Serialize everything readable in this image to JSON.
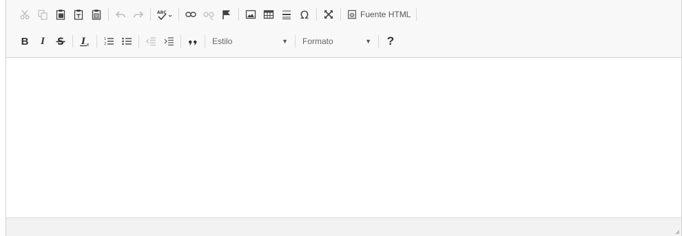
{
  "toolbar": {
    "row1": {
      "buttons": [
        {
          "name": "cut-button",
          "icon": "scissors-icon",
          "enabled": false
        },
        {
          "name": "copy-button",
          "icon": "copy-icon",
          "enabled": false
        },
        {
          "name": "paste-button",
          "icon": "clipboard-icon",
          "enabled": true
        },
        {
          "name": "paste-text-button",
          "icon": "clipboard-text-icon",
          "enabled": true
        },
        {
          "name": "paste-word-button",
          "icon": "clipboard-word-icon",
          "enabled": true
        },
        {
          "name": "undo-button",
          "icon": "undo-icon",
          "enabled": false
        },
        {
          "name": "redo-button",
          "icon": "redo-icon",
          "enabled": false
        },
        {
          "name": "spellcheck-button",
          "icon": "spellcheck-icon",
          "enabled": true
        },
        {
          "name": "link-button",
          "icon": "link-icon",
          "enabled": true
        },
        {
          "name": "unlink-button",
          "icon": "unlink-icon",
          "enabled": false
        },
        {
          "name": "anchor-button",
          "icon": "flag-icon",
          "enabled": true
        },
        {
          "name": "image-button",
          "icon": "image-icon",
          "enabled": true
        },
        {
          "name": "table-button",
          "icon": "table-icon",
          "enabled": true
        },
        {
          "name": "horizontal-rule-button",
          "icon": "horizontal-rule-icon",
          "enabled": true
        },
        {
          "name": "special-char-button",
          "icon": "omega-icon",
          "enabled": true
        },
        {
          "name": "maximize-button",
          "icon": "maximize-icon",
          "enabled": true
        }
      ],
      "source_label": "Fuente HTML"
    },
    "row2": {
      "bold_glyph": "B",
      "italic_glyph": "I",
      "estilo_label": "Estilo",
      "formato_label": "Formato",
      "help_glyph": "?"
    }
  },
  "colors": {
    "toolbar_bg": "#f8f8f8",
    "border": "#d1d1d1",
    "icon": "#444444",
    "icon_disabled": "#bdbdbd",
    "statusbar_bg": "#f2f2f2"
  }
}
